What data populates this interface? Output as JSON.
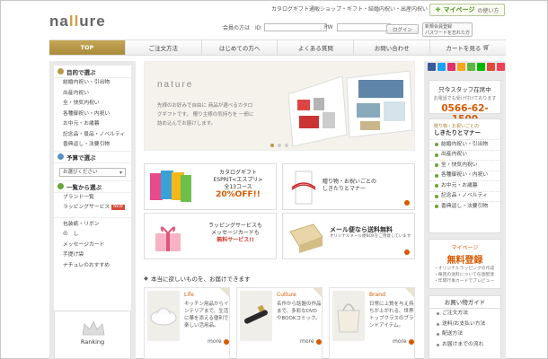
{
  "header": {
    "logo": "nature",
    "tagline": "カタログギフト通販ショップ・ギフト・結婚内祝い・出産内祝い",
    "mypage_label": "マイページ",
    "mypage_sub": "の使い方",
    "id_label": "会員の方は　ID",
    "pw_label": "PW",
    "login_label": "ログイン",
    "register_line1": "新規会員登録",
    "register_line2": "パスワードを忘れた方"
  },
  "nav": [
    {
      "label": "TOP",
      "active": true
    },
    {
      "label": "ご注文方法"
    },
    {
      "label": "はじめての方へ"
    },
    {
      "label": "よくある質問"
    },
    {
      "label": "お問い合わせ"
    },
    {
      "label": "カートを見る"
    }
  ],
  "left_sidebar": {
    "purpose_title": "目的で選ぶ",
    "purpose_items": [
      "結婚内祝い・引出物",
      "出産内祝い",
      "全・快気内祝い",
      "各種御祝い・内祝い",
      "お中元・お歳暮",
      "記念品・景品・ノベルティ",
      "香典返し・法要引物"
    ],
    "budget_title": "予算で選ぶ",
    "budget_select": "お選びください",
    "list_title": "一覧から選ぶ",
    "list_items": [
      "ブランド一覧",
      "ラッピングサービス"
    ],
    "new_badge": "NEW",
    "other_items": [
      "包装紙・リボン",
      "の　し",
      "メッセージカード",
      "手提げ袋",
      "ナチュレのおすすめ"
    ],
    "ranking_label": "Ranking"
  },
  "hero": {
    "logo": "nature",
    "text": "先様のお好みで自由に 商品が選べるカタログギフトです。 贈り主様の気持ちを 一冊に詰め込んでお届けします。"
  },
  "tiles": {
    "catalog": {
      "line1": "カタログギフト",
      "line2": "ESPRIT<エスプリ>",
      "line3": "全13コース",
      "line4": "20%OFF!!"
    },
    "manner": {
      "line1": "贈り物・お祝いごとの",
      "line2": "しきたりとマナー"
    },
    "wrapping": {
      "line1": "ラッピングサービスも",
      "line2": "メッセージカードも",
      "line3": "無料サービス!!"
    },
    "shipping": {
      "line1": "メール便なら送料無料",
      "line2": "オリジナルメール便BOXをご用意しています"
    }
  },
  "section_title": "本当に欲しいものを、お届けできます",
  "cards": [
    {
      "cat": "Life",
      "desc": "キッチン用品からインテリアまで、生活に華を添える便利で楽しい活用品。",
      "more": "more"
    },
    {
      "cat": "Culture",
      "desc": "名作から話題の作品まで、多彩なDVDやBOOKコミック。",
      "more": "more"
    },
    {
      "cat": "Brand",
      "desc": "日常に上質を与え持ちが上がれる、世界トップクラスのブランドアイテム。",
      "more": "more"
    }
  ],
  "right_sidebar": {
    "staff_title": "只今スタッフ在席中",
    "staff_sub": "お電話でも受け付けております",
    "tel": "0566-62-1500",
    "manner_sub": "贈り物・お祝いごとの",
    "manner_title": "しきたりとマナー",
    "manner_items": [
      "結婚内祝い・引出物",
      "出産内祝い",
      "全・快気内祝い",
      "各種御祝い・内祝い",
      "お中元・お歳暮",
      "記念品・ノベルティ",
      "香典返し・法要引物"
    ],
    "register_top": "マイページ",
    "register_main": "無料登録",
    "register_notes": [
      "・オリジナルラッピングの作成",
      "・毎回の送料について任意配達",
      "・年間行事カードでプレビュー"
    ],
    "guide_title": "お買い物ガイド",
    "guide_items": [
      "ご注文方法",
      "送料/お支払い方法",
      "配送方法",
      "お届けまでの流れ"
    ]
  },
  "social_colors": [
    "#3b5998",
    "#1da1f2",
    "#e1306c",
    "#f4a51c",
    "#5fb742",
    "#00b900",
    "#dd4b39",
    "#ef4056"
  ]
}
